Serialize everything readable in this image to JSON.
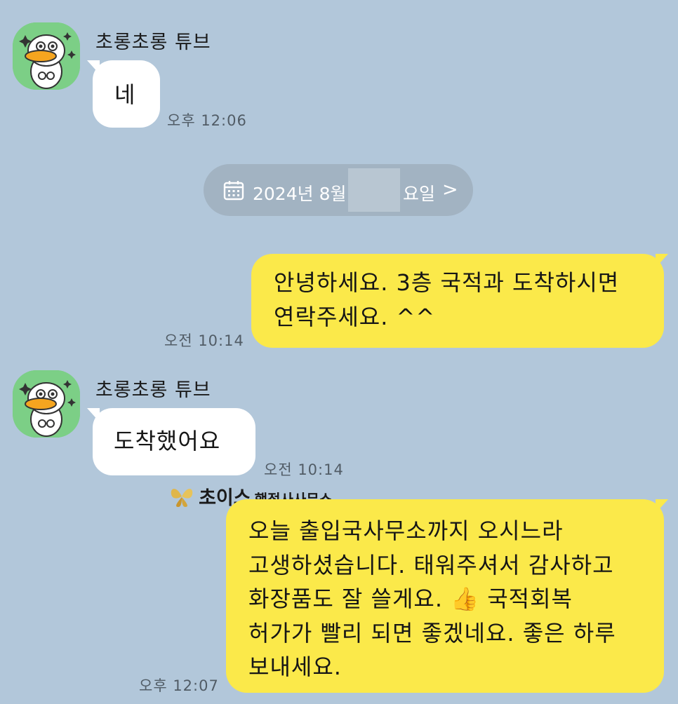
{
  "messages": [
    {
      "sender": "초롱초롱 튜브",
      "text": "네",
      "time": "오후 12:06"
    },
    {
      "date_divider": {
        "prefix": "2024년 8월",
        "suffix": "요일",
        "arrow": ">",
        "icon": "calendar-icon"
      }
    },
    {
      "lines": [
        "안녕하세요. 3층 국적과 도착하시면",
        "연락주세요. ^^"
      ],
      "time": "오전 10:14"
    },
    {
      "sender": "초롱초롱 튜브",
      "text": "도착했어요",
      "time": "오전 10:14"
    },
    {
      "brand": {
        "name": "초이스",
        "sub": "행정사사무소"
      },
      "lines": [
        "오늘 출입국사무소까지 오시느라",
        "고생하셨습니다. 태워주셔서 감사하고",
        "화장품도 잘 쓸게요. 👍 국적회복",
        "허가가 빨리 되면 좋겠네요. 좋은 하루",
        "보내세요."
      ],
      "time": "오후 12:07"
    }
  ],
  "colors": {
    "background": "#b2c7da",
    "incoming_bubble": "#ffffff",
    "outgoing_bubble": "#fbe94a",
    "avatar_bg": "#7ccf86",
    "date_pill": "#a2b3c2"
  }
}
